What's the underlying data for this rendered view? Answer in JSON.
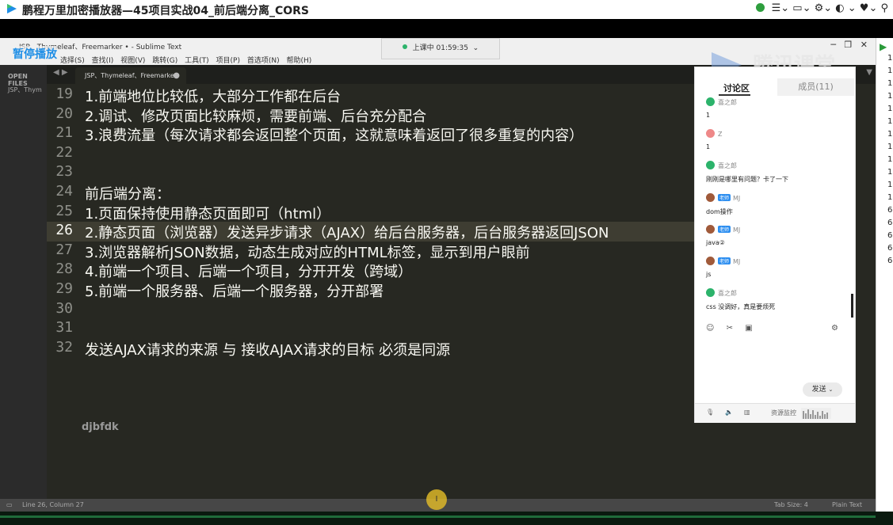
{
  "player": {
    "title": "鹏程万里加密播放器—45项目实战04_前后端分离_CORS",
    "sys_icons": "☰⌄ ▭⌄ ⚙⌄ ◐ ⌄ ♥⌄ ⚲"
  },
  "sublime": {
    "title": "JSP、Thymeleaf、Freemarker • - Sublime Text",
    "pause_label": "暂停播放",
    "menu": [
      "选择(S)",
      "查找(I)",
      "视图(V)",
      "跳转(G)",
      "工具(T)",
      "项目(P)",
      "首选项(N)",
      "帮助(H)"
    ],
    "sidebar_header": "OPEN FILES",
    "sidebar_file": "JSP、Thym",
    "tab_label": "JSP、Thymeleaf、Freemarker",
    "tab_dot": "●",
    "tab_arrows": "◀ ▶",
    "tab_dropdown": "▼",
    "lines": [
      {
        "num": "19",
        "text": "1.前端地位比较低，大部分工作都在后台"
      },
      {
        "num": "20",
        "text": "2.调试、修改页面比较麻烦，需要前端、后台充分配合"
      },
      {
        "num": "21",
        "text": "3.浪费流量（每次请求都会返回整个页面，这就意味着返回了很多重复的内容）"
      },
      {
        "num": "22",
        "text": ""
      },
      {
        "num": "23",
        "text": ""
      },
      {
        "num": "24",
        "text": "前后端分离："
      },
      {
        "num": "25",
        "text": "1.页面保持使用静态页面即可（html）"
      },
      {
        "num": "26",
        "text": "2.静态页面（浏览器）发送异步请求（AJAX）给后台服务器，后台服务器返回JSON"
      },
      {
        "num": "27",
        "text": "3.浏览器解析JSON数据，动态生成对应的HTML标签，显示到用户眼前"
      },
      {
        "num": "28",
        "text": "4.前端一个项目、后端一个项目，分开开发（跨域）"
      },
      {
        "num": "29",
        "text": "5.前端一个服务器、后端一个服务器，分开部署"
      },
      {
        "num": "30",
        "text": ""
      },
      {
        "num": "31",
        "text": ""
      },
      {
        "num": "32",
        "text": "发送AJAX请求的来源 与 接收AJAX请求的目标  必须是同源"
      }
    ],
    "doodle": "djbfdk",
    "status_left": "Line 26, Column 27",
    "status_tab": "Tab Size: 4",
    "status_syntax": "Plain Text"
  },
  "live": {
    "label": "上课中 01:59:35"
  },
  "watermark": "腾讯课堂",
  "chat": {
    "tab_discuss": "讨论区",
    "tab_members": "成员(11)",
    "messages": [
      {
        "name": "喜之郎",
        "teacher": false,
        "text": "1",
        "color": "#2cb36b"
      },
      {
        "name": "Z",
        "teacher": false,
        "text": "1",
        "color": "#e88"
      },
      {
        "name": "喜之郎",
        "teacher": false,
        "text": "刚刚是哪里有问题？卡了一下",
        "color": "#2cb36b"
      },
      {
        "name": "MJ",
        "teacher": true,
        "text": "dom操作",
        "color": "#a05a3a"
      },
      {
        "name": "MJ",
        "teacher": true,
        "text": "java②",
        "color": "#a05a3a"
      },
      {
        "name": "MJ",
        "teacher": true,
        "text": "js",
        "color": "#a05a3a"
      },
      {
        "name": "喜之郎",
        "teacher": false,
        "text": "css 没调好，真是要烦死",
        "color": "#2cb36b"
      }
    ],
    "teacher_badge": "老师",
    "send_label": "发送",
    "resource_monitor": "资源监控"
  },
  "ruler": {
    "digits": [
      "1",
      "1",
      "1",
      "1",
      "1",
      "1",
      "1",
      "1",
      "1",
      "1",
      "1",
      "1",
      "6",
      "6",
      "6",
      "6",
      "6"
    ]
  },
  "cursor_glyph": "I",
  "colors": {
    "editor_bg": "#272822",
    "accent_blue": "#1e8ee6",
    "green": "#2e9e3e"
  }
}
